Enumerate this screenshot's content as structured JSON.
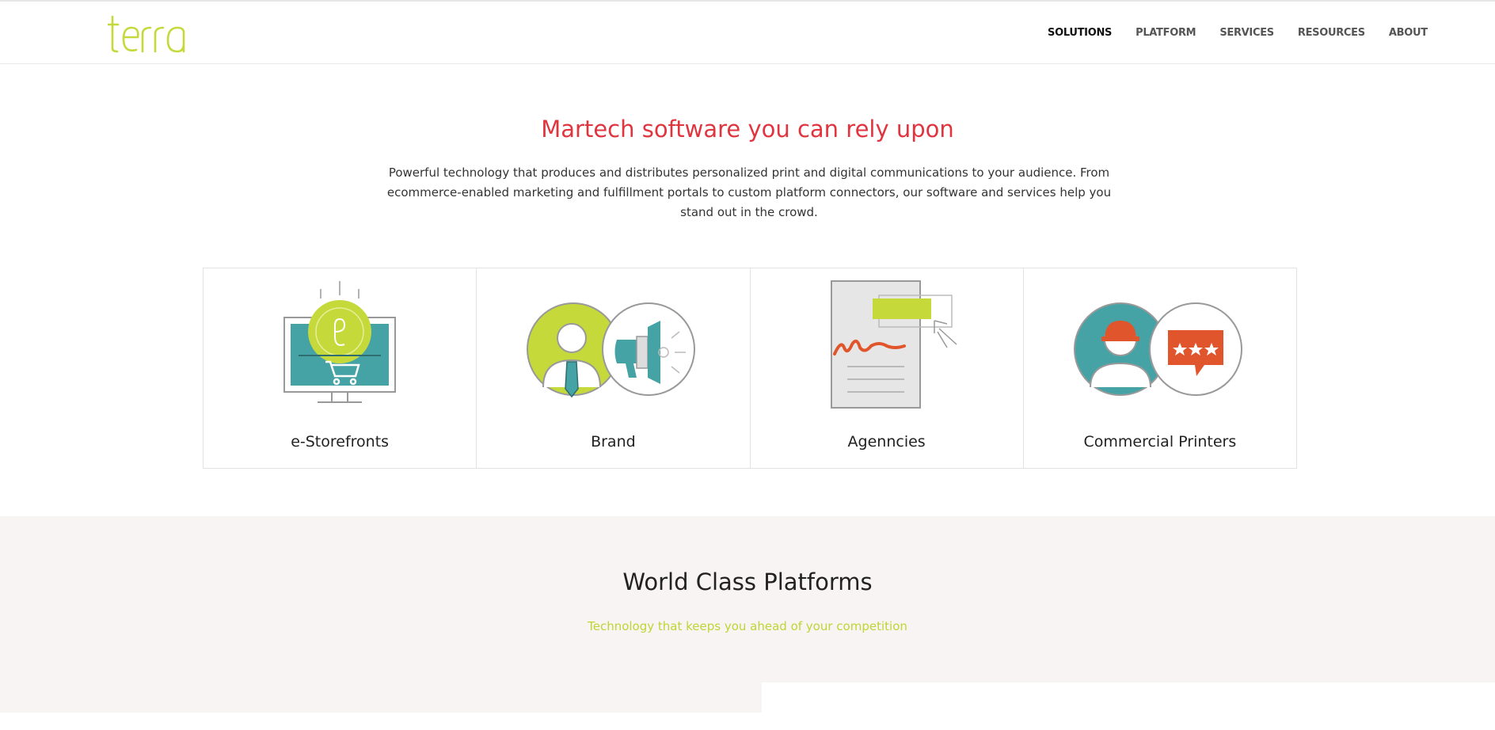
{
  "header": {
    "logo_text": "terra",
    "nav": [
      {
        "label": "SOLUTIONS",
        "active": true
      },
      {
        "label": "PLATFORM",
        "active": false
      },
      {
        "label": "SERVICES",
        "active": false
      },
      {
        "label": "RESOURCES",
        "active": false
      },
      {
        "label": "ABOUT",
        "active": false
      }
    ]
  },
  "hero": {
    "title": "Martech software you can rely upon",
    "text": "Powerful technology that produces and distributes personalized print and digital communications to your audience. From ecommerce-enabled marketing and fulfillment portals to custom platform connectors, our software and services help you stand out in the crowd."
  },
  "cards": [
    {
      "label": "e-Storefronts",
      "icon": "storefront-icon"
    },
    {
      "label": "Brand",
      "icon": "brand-megaphone-icon"
    },
    {
      "label": "Agenncies",
      "icon": "agency-document-icon"
    },
    {
      "label": "Commercial Printers",
      "icon": "printer-rating-icon"
    }
  ],
  "platforms": {
    "title": "World Class Platforms",
    "subtitle": "Technology that keeps you ahead of your competition"
  },
  "colors": {
    "accent_red": "#e0353f",
    "lime": "#bfd533",
    "teal": "#45a3a6",
    "orange": "#e0552b",
    "section_bg": "#f7f4f3"
  }
}
